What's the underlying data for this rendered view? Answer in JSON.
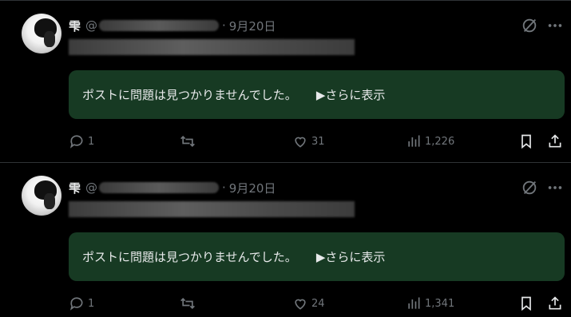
{
  "posts": [
    {
      "author": {
        "name": "雫",
        "handle_prefix": "@"
      },
      "date": "9月20日",
      "separator": "·",
      "notice": {
        "text": "ポストに問題は見つかりませんでした。",
        "show_more": "▶さらに表示"
      },
      "actions": {
        "replies": "1",
        "reposts": "",
        "likes": "31",
        "views": "1,226"
      }
    },
    {
      "author": {
        "name": "雫",
        "handle_prefix": "@"
      },
      "date": "9月20日",
      "separator": "·",
      "notice": {
        "text": "ポストに問題は見つかりませんでした。",
        "show_more": "▶さらに表示"
      },
      "actions": {
        "replies": "1",
        "reposts": "",
        "likes": "24",
        "views": "1,341"
      }
    }
  ],
  "icons": {
    "reply": "reply-icon",
    "repost": "repost-icon",
    "like": "heart-icon",
    "views": "views-icon",
    "bookmark": "bookmark-icon",
    "share": "share-icon",
    "grok": "grok-icon",
    "more": "more-icon"
  },
  "colors": {
    "background": "#000000",
    "notice_background": "#173a23",
    "text_primary": "#e7e9ea",
    "text_secondary": "#71767b",
    "divider": "#2f3336"
  }
}
